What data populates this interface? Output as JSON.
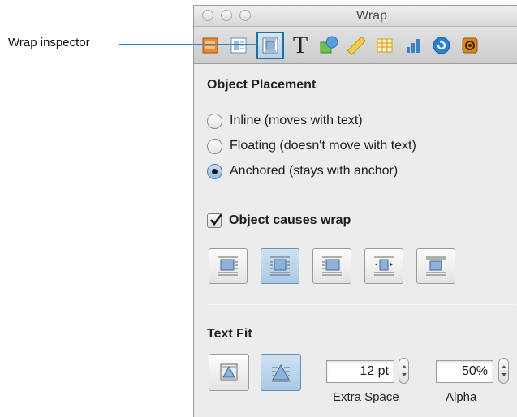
{
  "callout": {
    "label": "Wrap inspector",
    "color": "#2a86c6"
  },
  "window": {
    "title": "Wrap"
  },
  "toolbar": {
    "icons": [
      "document-icon",
      "layout-icon",
      "wrap-icon",
      "text-icon",
      "graphic-icon",
      "metrics-icon",
      "table-icon",
      "chart-icon",
      "link-icon",
      "quicktime-icon"
    ],
    "selected": "wrap-icon"
  },
  "object_placement": {
    "title": "Object Placement",
    "options": [
      {
        "label": "Inline (moves with text)",
        "selected": false
      },
      {
        "label": "Floating (doesn't move with text)",
        "selected": false
      },
      {
        "label": "Anchored (stays with anchor)",
        "selected": true
      }
    ]
  },
  "wrap": {
    "checkbox_label": "Object causes wrap",
    "checked": true,
    "styles": [
      "wrap-left-icon",
      "wrap-both-icon",
      "wrap-right-icon",
      "wrap-largest-icon",
      "wrap-none-icon"
    ],
    "active_index": 1
  },
  "text_fit": {
    "title": "Text Fit",
    "buttons": [
      "fit-rect-icon",
      "fit-contour-icon"
    ],
    "active_index": 1,
    "extra_space": {
      "value": "12 pt",
      "label": "Extra Space"
    },
    "alpha": {
      "value": "50%",
      "label": "Alpha"
    }
  }
}
